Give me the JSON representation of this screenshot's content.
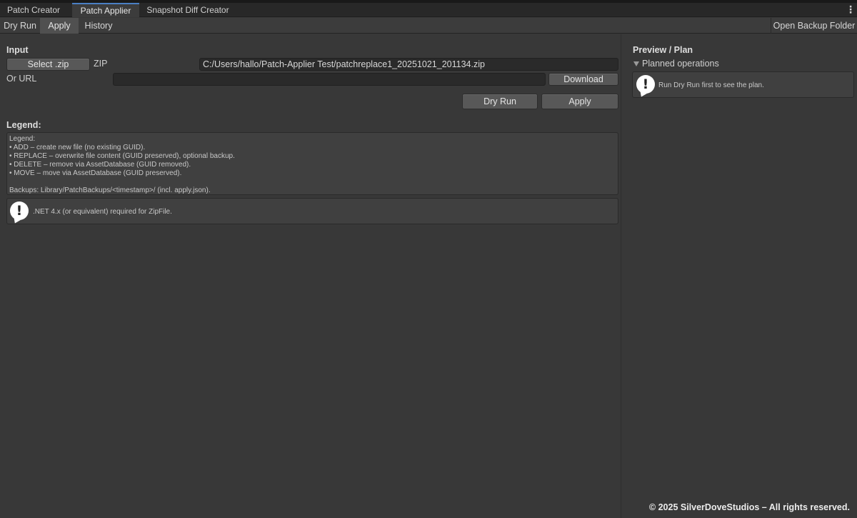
{
  "tabs": [
    {
      "label": "Patch Creator"
    },
    {
      "label": "Patch Applier"
    },
    {
      "label": "Snapshot Diff Creator"
    }
  ],
  "kebab_label": "⋮",
  "toolbar": {
    "dry_run": "Dry Run",
    "apply": "Apply",
    "history": "History",
    "open_backup": "Open Backup Folder"
  },
  "input": {
    "title": "Input",
    "select_zip": "Select .zip",
    "zip_label": "ZIP",
    "zip_path": "C:/Users/hallo/Patch-Applier Test/patchreplace1_20251021_201134.zip",
    "url_label": "Or URL",
    "url_value": "",
    "download": "Download",
    "dry_run": "Dry Run",
    "apply": "Apply"
  },
  "legend": {
    "title": "Legend:",
    "text": "Legend:\n• ADD – create new file (no existing GUID).\n• REPLACE – overwrite file content (GUID preserved), optional backup.\n• DELETE – remove via AssetDatabase (GUID removed).\n• MOVE – move via AssetDatabase (GUID preserved).\n\nBackups: Library/PatchBackups/<timestamp>/ (incl. apply.json).",
    "warning": ".NET 4.x (or equivalent) required for ZipFile."
  },
  "preview": {
    "title": "Preview / Plan",
    "foldout": "Planned operations",
    "hint": "Run Dry Run first to see the plan."
  },
  "icons": {
    "warning": "exclamation-bubble-icon",
    "foldout": "triangle-down-icon"
  },
  "footer": "© 2025 SilverDoveStudios – All rights reserved."
}
